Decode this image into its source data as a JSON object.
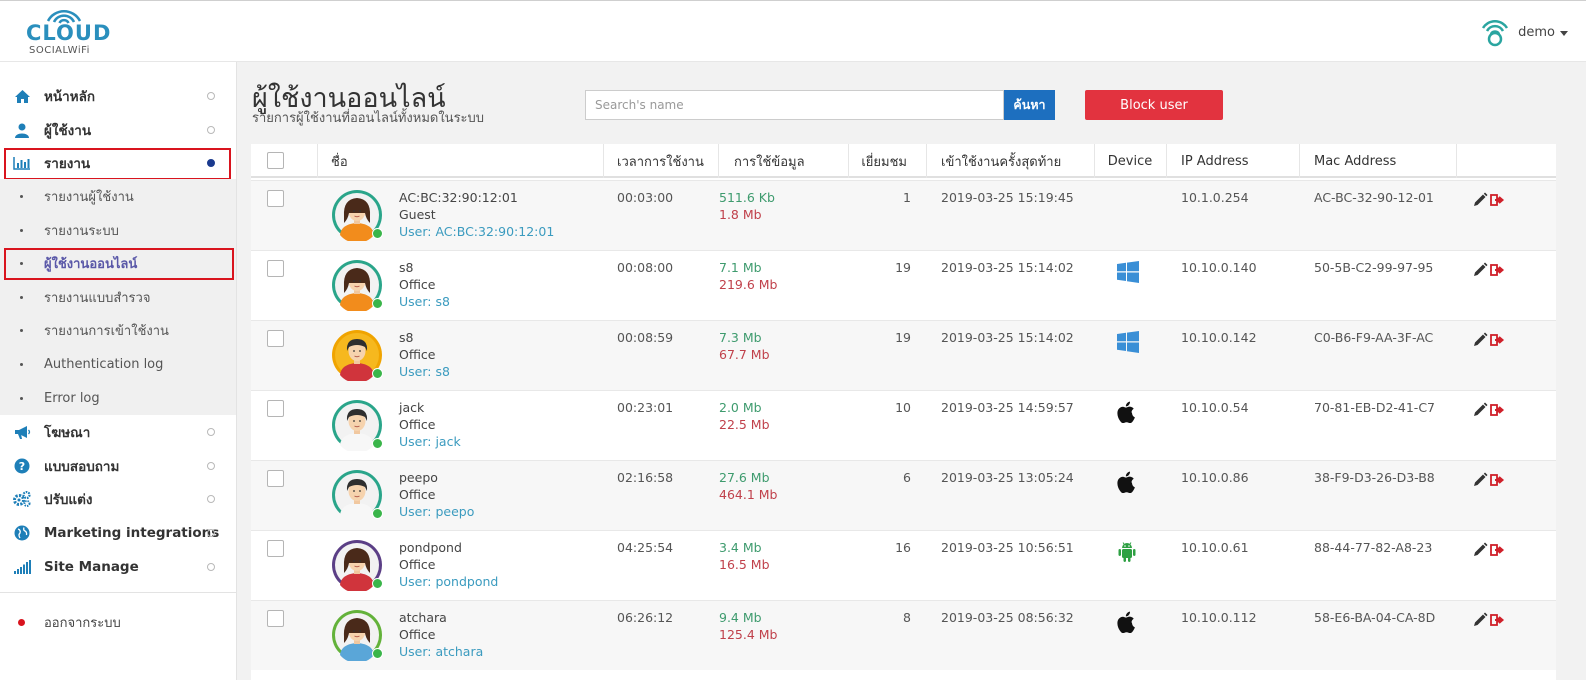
{
  "header": {
    "logo_text": "CLOUD",
    "logo_sub": "SOCIALWiFi",
    "username": "demo"
  },
  "sidebar": {
    "items": [
      {
        "label": "หน้าหลัก",
        "icon": "home-icon"
      },
      {
        "label": "ผู้ใช้งาน",
        "icon": "user-icon"
      },
      {
        "label": "รายงาน",
        "icon": "bar-chart-icon"
      }
    ],
    "submenu": [
      {
        "label": "รายงานผู้ใช้งาน"
      },
      {
        "label": "รายงานระบบ"
      },
      {
        "label": "ผู้ใช้งานออนไลน์"
      },
      {
        "label": "รายงานแบบสำรวจ"
      },
      {
        "label": "รายงานการเข้าใช้งาน"
      },
      {
        "label": "Authentication log"
      },
      {
        "label": "Error log"
      }
    ],
    "items2": [
      {
        "label": "โฆษณา",
        "icon": "megaphone-icon"
      },
      {
        "label": "แบบสอบถาม",
        "icon": "question-icon"
      },
      {
        "label": "ปรับแต่ง",
        "icon": "gears-icon"
      },
      {
        "label": "Marketing integrations",
        "icon": "globe-icon"
      },
      {
        "label": "Site Manage",
        "icon": "signal-icon"
      }
    ],
    "logout": "ออกจากระบบ"
  },
  "main": {
    "title": "ผู้ใช้งานออนไลน์",
    "subtitle": "รายการผู้ใช้งานที่ออนไลน์ทั้งหมดในระบบ",
    "search_placeholder": "Search's name",
    "search_button": "ค้นหา",
    "block_button": "Block user"
  },
  "table": {
    "headers": {
      "name": "ชื่อ",
      "time": "เวลาการใช้งาน",
      "data": "การใช้ข้อมูล",
      "visits": "เยี่ยมชม",
      "last_login": "เข้าใช้งานครั้งสุดท้าย",
      "device": "Device",
      "ip": "IP Address",
      "mac": "Mac Address"
    },
    "rows": [
      {
        "name": "AC:BC:32:90:12:01",
        "group": "Guest",
        "user": "User: AC:BC:32:90:12:01",
        "time": "00:03:00",
        "up": "511.6 Kb",
        "down": "1.8 Mb",
        "visits": "1",
        "last": "2019-03-25 15:19:45",
        "device": "",
        "ip": "10.1.0.254",
        "mac": "AC-BC-32-90-12-01",
        "avatar": "female",
        "ring": "#2aa58a"
      },
      {
        "name": "s8",
        "group": "Office",
        "user": "User: s8",
        "time": "00:08:00",
        "up": "7.1 Mb",
        "down": "219.6 Mb",
        "visits": "19",
        "last": "2019-03-25 15:14:02",
        "device": "windows",
        "ip": "10.10.0.140",
        "mac": "50-5B-C2-99-97-95",
        "avatar": "female",
        "ring": "#2aa58a"
      },
      {
        "name": "s8",
        "group": "Office",
        "user": "User: s8",
        "time": "00:08:59",
        "up": "7.3 Mb",
        "down": "67.7 Mb",
        "visits": "19",
        "last": "2019-03-25 15:14:02",
        "device": "windows",
        "ip": "10.10.0.142",
        "mac": "C0-B6-F9-AA-3F-AC",
        "avatar": "male-red",
        "ring": "#f0a400"
      },
      {
        "name": "jack",
        "group": "Office",
        "user": "User: jack",
        "time": "00:23:01",
        "up": "2.0 Mb",
        "down": "22.5 Mb",
        "visits": "10",
        "last": "2019-03-25 14:59:57",
        "device": "apple",
        "ip": "10.10.0.54",
        "mac": "70-81-EB-D2-41-C7",
        "avatar": "male",
        "ring": "#2aa58a"
      },
      {
        "name": "peepo",
        "group": "Office",
        "user": "User: peepo",
        "time": "02:16:58",
        "up": "27.6 Mb",
        "down": "464.1 Mb",
        "visits": "6",
        "last": "2019-03-25 13:05:24",
        "device": "apple",
        "ip": "10.10.0.86",
        "mac": "38-F9-D3-26-D3-B8",
        "avatar": "male",
        "ring": "#2aa58a"
      },
      {
        "name": "pondpond",
        "group": "Office",
        "user": "User: pondpond",
        "time": "04:25:54",
        "up": "3.4 Mb",
        "down": "16.5 Mb",
        "visits": "16",
        "last": "2019-03-25 10:56:51",
        "device": "android",
        "ip": "10.10.0.61",
        "mac": "88-44-77-82-A8-23",
        "avatar": "female-red",
        "ring": "#5b3f86"
      },
      {
        "name": "atchara",
        "group": "Office",
        "user": "User: atchara",
        "time": "06:26:12",
        "up": "9.4 Mb",
        "down": "125.4 Mb",
        "visits": "8",
        "last": "2019-03-25 08:56:32",
        "device": "apple",
        "ip": "10.10.0.112",
        "mac": "58-E6-BA-04-CA-8D",
        "avatar": "female-blue",
        "ring": "#63b23a"
      }
    ]
  },
  "colors": {
    "brand": "#2a8fbd",
    "search_button": "#1d6fbf",
    "block_button": "#e2333f",
    "upload": "#3e9b6e",
    "download": "#c0414b",
    "highlight_box": "#d9141e"
  }
}
